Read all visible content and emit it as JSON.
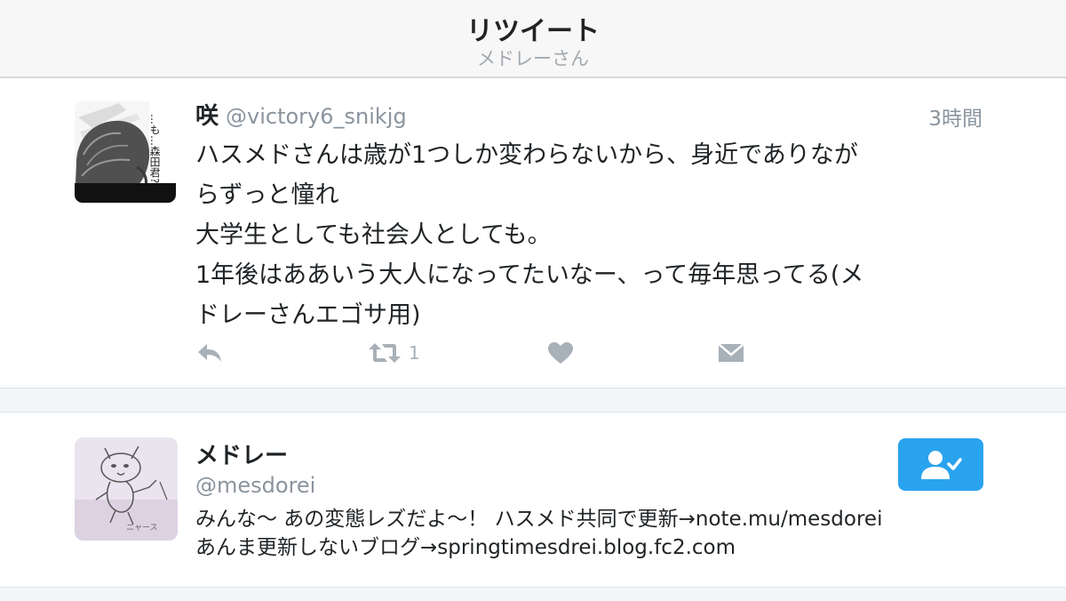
{
  "header": {
    "title": "リツイート",
    "subtitle": "メドレーさん"
  },
  "tweet": {
    "author_name": "咲",
    "author_handle": "@victory6_snikjg",
    "time": "3時間",
    "text_lines": [
      "ハスメドさんは歳が1つしか変わらないから、身近でありなが",
      "らずっと憧れ",
      "大学生としても社会人としても。",
      "1年後はああいう大人になってたいなー、って毎年思ってる(メ",
      "ドレーさんエゴサ用)"
    ],
    "retweet_count": "1",
    "avatar_text": "…も…森田君?",
    "actions": {
      "reply_icon": "reply-icon",
      "retweet_icon": "retweet-icon",
      "like_icon": "heart-icon",
      "dm_icon": "envelope-icon"
    }
  },
  "user": {
    "name": "メドレー",
    "handle": "@mesdorei",
    "bio_lines": [
      "みんな〜 あの変態レズだよ〜！ ハスメド共同で更新→note.mu/mesdorei",
      "あんま更新しないブログ→springtimesdrei.blog.fc2.com"
    ],
    "avatar_text": "ニャース",
    "follow_icon": "following-user-check-icon"
  },
  "colors": {
    "accent": "#2aa3ef",
    "icon_gray": "#a8b0b8",
    "secondary_text": "#8a949e",
    "header_bg": "#f7f7f7",
    "separator_bg": "#f3f5f7"
  }
}
